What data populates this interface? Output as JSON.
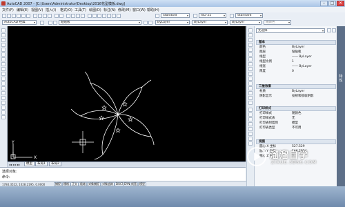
{
  "window": {
    "title": "AutoCAD 2007 - [C:\\Users\\Administrator\\Desktop\\2016花型模板.dwg]",
    "min": "–",
    "max": "□",
    "close": "✕"
  },
  "menu": [
    "文件(F)",
    "编辑(E)",
    "视图(V)",
    "插入(I)",
    "格式(O)",
    "工具(T)",
    "绘图(D)",
    "标注(N)",
    "修改(M)",
    "窗口(W)",
    "帮助(H)"
  ],
  "toolbar": {
    "text_style": "Standard",
    "dim_style": "ISO-25",
    "table_style": "Standard",
    "workspace": "AutoCAD 经典",
    "layer": "粘贴板",
    "color": "ByLayer",
    "linetype": "ByLayer",
    "lineweight": "ByLayer",
    "plotstyle": "随颜色"
  },
  "tabs": [
    "模型",
    "布局1",
    "布局2"
  ],
  "command": {
    "line1": "选择对象:",
    "line2": "命令:"
  },
  "status": {
    "coords": "1784.3522, 1028.2195, 0.0000",
    "buttons": [
      "捕捉",
      "栅格",
      "正交",
      "极轴",
      "对象捕捉",
      "对象追踪",
      "DUCS",
      "DYN",
      "线宽",
      "模型"
    ]
  },
  "properties": {
    "selection": "无选择",
    "sections": [
      {
        "title": "基本",
        "rows": [
          {
            "k": "颜色",
            "v": "ByLayer"
          },
          {
            "k": "图层",
            "v": "粘贴板"
          },
          {
            "k": "线型",
            "v": "—— ByLayer"
          },
          {
            "k": "线型比例",
            "v": "1"
          },
          {
            "k": "线宽",
            "v": "—— ByLayer"
          },
          {
            "k": "厚度",
            "v": "0"
          }
        ]
      },
      {
        "title": "三维效果",
        "rows": [
          {
            "k": "材质",
            "v": "ByLayer"
          },
          {
            "k": "阴影显示",
            "v": "投射和接收阴影"
          }
        ]
      },
      {
        "title": "打印样式",
        "rows": [
          {
            "k": "打印样式",
            "v": "随颜色"
          },
          {
            "k": "打印样式表",
            "v": "无"
          },
          {
            "k": "打印表附着到",
            "v": "模型"
          },
          {
            "k": "打印表类型",
            "v": "不可用"
          }
        ]
      },
      {
        "title": "视图",
        "rows": [
          {
            "k": "圆心 X 坐标",
            "v": "527.529"
          },
          {
            "k": "圆心 Y 坐标",
            "v": "146.2924"
          },
          {
            "k": "圆心 Z 坐标",
            "v": "0"
          }
        ]
      }
    ],
    "side_label": "特性"
  },
  "ucs": {
    "x": "X",
    "y": "Y"
  },
  "watermark": {
    "name": "溜溜自学",
    "url": "ZIXUE.3D66.COM"
  },
  "colors": {
    "canvas": "#000000",
    "drawing": "#ffffff",
    "accent": "#2b6cb3"
  }
}
